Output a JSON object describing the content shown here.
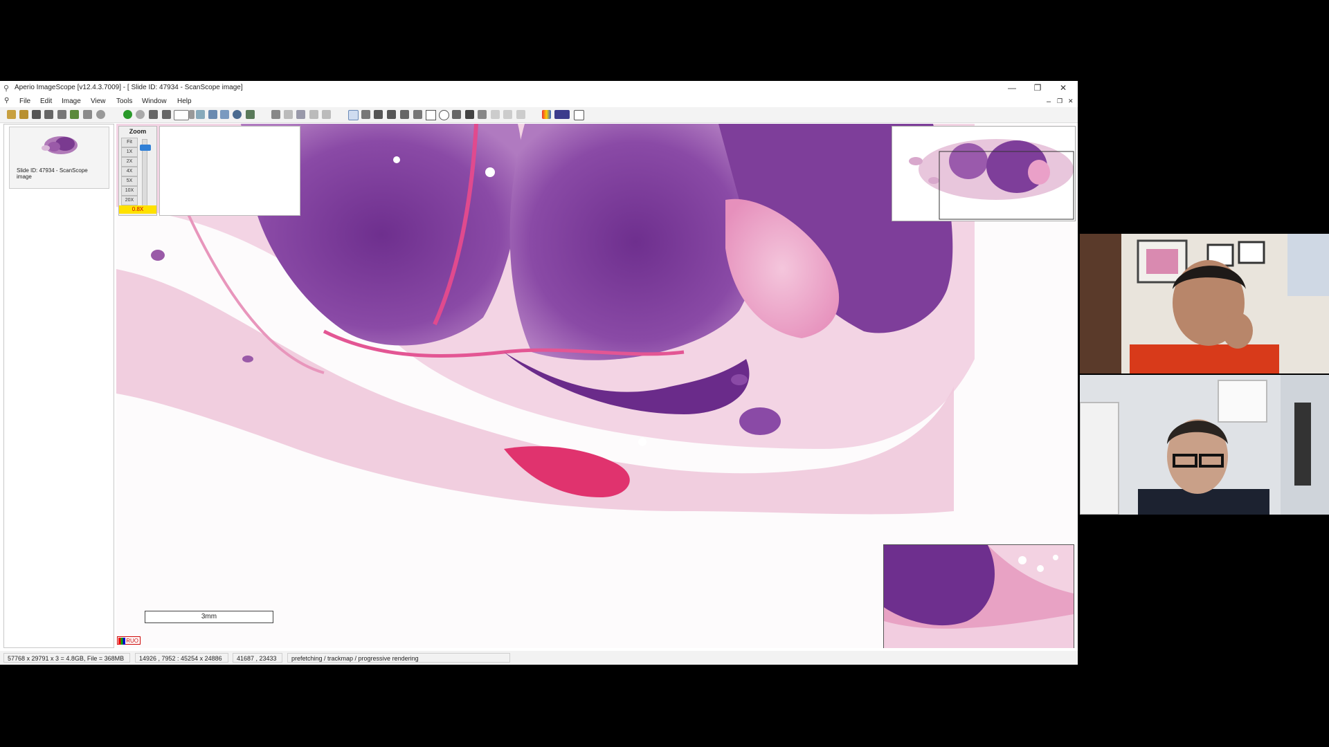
{
  "window": {
    "title": "Aperio ImageScope [v12.4.3.7009] - [ Slide ID: 47934 - ScanScope image]",
    "app_icon": "microscope-icon",
    "minimize": "—",
    "restore": "❐",
    "close": "✕"
  },
  "menu": {
    "items": [
      "File",
      "Edit",
      "Image",
      "View",
      "Tools",
      "Window",
      "Help"
    ],
    "doc_min": "–",
    "doc_restore": "❐",
    "doc_close": "✕"
  },
  "toolbar": {
    "icons": [
      "open-folder-icon",
      "open-icon",
      "camera-icon",
      "snapshot-icon",
      "print-icon",
      "export-icon",
      "tools-icon",
      "info-icon",
      "back-green-icon",
      "forward-gray-icon",
      "fit-icon",
      "sync-icon",
      "region-select-icon",
      "dropdown-icon",
      "pin-icon",
      "view-mode-icon",
      "compare-icon",
      "magnify-icon",
      "grid-view-icon",
      "edit-icon",
      "lock-icon",
      "layers-icon",
      "rotate-icon",
      "link-icon",
      "pan-hand-icon",
      "select-arrow-icon",
      "snapshot2-icon",
      "pen-icon",
      "negative-pen-icon",
      "ruler-icon",
      "rectangle-icon",
      "ellipse-icon",
      "arrow-icon",
      "hash-icon",
      "table-icon",
      "curve-icon",
      "copy-icon",
      "paste-icon",
      "color-adjust-icon",
      "channel-icon",
      "help-icon"
    ]
  },
  "thumbnail": {
    "caption": "Slide ID: 47934 - ScanScope image"
  },
  "zoom": {
    "title": "Zoom",
    "levels": [
      "Fit",
      "1X",
      "2X",
      "4X",
      "5X",
      "10X",
      "20X"
    ],
    "current": "0.8X"
  },
  "scalebar": {
    "label": "3mm"
  },
  "ruo": {
    "label": "RUO"
  },
  "status": {
    "dimensions": "57768 x 29791 x 3 = 4.8GB, File = 368MB",
    "view_region": "14926 , 7952 : 45254 x 24886",
    "cursor": "41687 , 23433",
    "message": "prefetching / trackmap / progressive rendering"
  }
}
